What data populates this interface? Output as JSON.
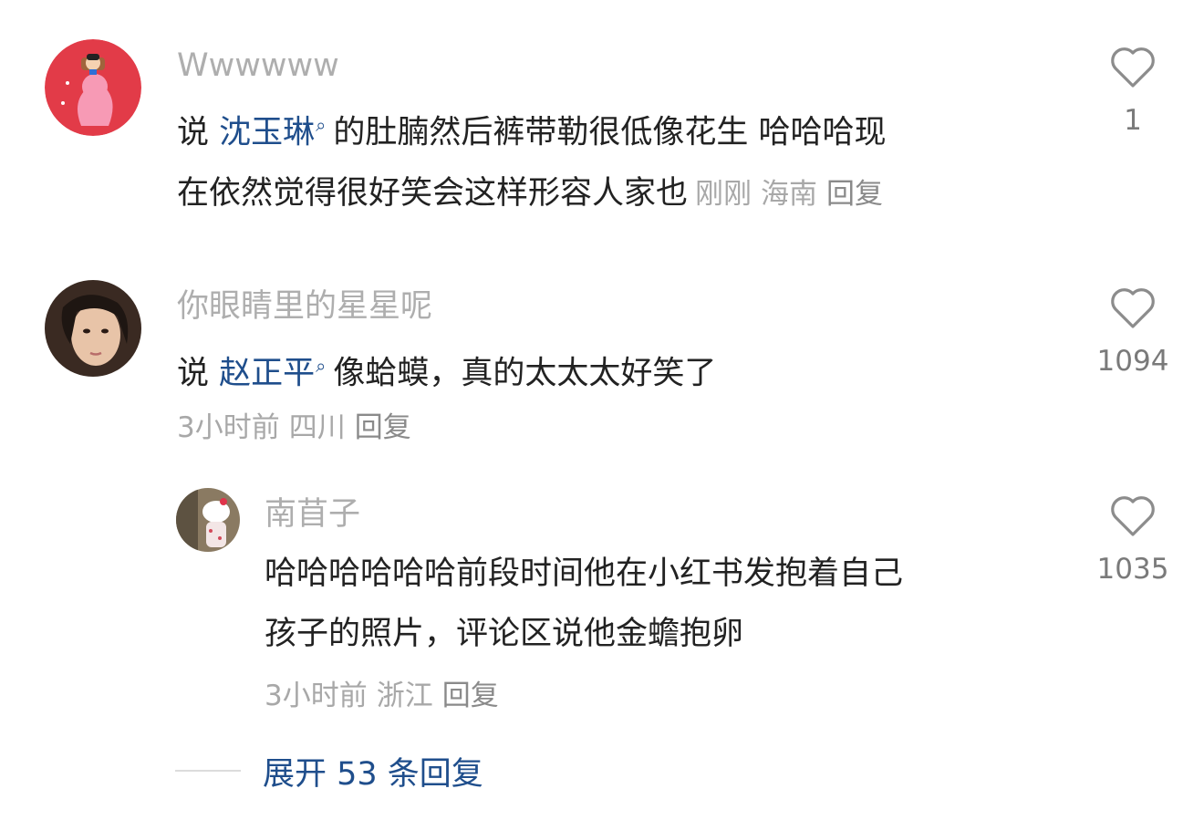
{
  "comments": [
    {
      "username": "Wwwwww",
      "line1_prefix": "说 ",
      "mention": "沈玉琳",
      "line1_suffix": "的肚腩然后裤带勒很低像花生 哈哈哈现",
      "line2": "在依然觉得很好笑会这样形容人家也",
      "time": "刚刚",
      "location": "海南",
      "reply_label": "回复",
      "likes": "1"
    },
    {
      "username": "你眼睛里的星星呢",
      "line1_prefix": "说 ",
      "mention": "赵正平",
      "line1_suffix": "像蛤蟆，真的太太太好笑了",
      "time": "3小时前",
      "location": "四川",
      "reply_label": "回复",
      "likes": "1094",
      "replies": [
        {
          "username": "南苜子",
          "line1": "哈哈哈哈哈哈前段时间他在小红书发抱着自己",
          "line2": "孩子的照片，评论区说他金蟾抱卵",
          "time": "3小时前",
          "location": "浙江",
          "reply_label": "回复",
          "likes": "1035"
        }
      ],
      "expand_label": "展开 53 条回复"
    }
  ],
  "icons": {
    "like": "heart-outline-icon",
    "mention": "search-icon"
  },
  "colors": {
    "mention": "#1f4e8c",
    "username": "#aeaeae",
    "text": "#222222",
    "meta": "#a8a8a8"
  }
}
